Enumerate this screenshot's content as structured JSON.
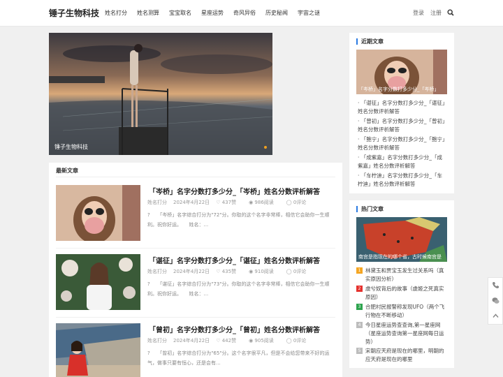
{
  "site": {
    "logo": "锤子生物科技"
  },
  "nav": [
    "姓名打分",
    "姓名测算",
    "宝宝取名",
    "星座运势",
    "奇风异俗",
    "历史秘闻",
    "宇宙之谜"
  ],
  "auth": {
    "login": "登录",
    "register": "注册"
  },
  "banner": {
    "caption": "锤子生物科技"
  },
  "latest": {
    "title": "最新文章",
    "articles": [
      {
        "title": "「岑桥」名字分数打多少分_「岑桥」姓名分数评析解答",
        "category": "姓名打分",
        "date": "2024年4月22日",
        "likes": "437赞",
        "views": "986阅读",
        "comments": "0评论",
        "excerpt": "?　　「岑桥」名字综合打分为\"72\"分。你取的这个名字非常棒，相信它会助你一生顺利。祝你好运。　　姓名：..."
      },
      {
        "title": "「谌征」名字分数打多少分_「谌征」姓名分数评析解答",
        "category": "姓名打分",
        "date": "2024年4月22日",
        "likes": "435赞",
        "views": "910阅读",
        "comments": "0评论",
        "excerpt": "?　　「谌征」名字综合打分为\"73\"分。你取的这个名字非常棒，相信它会助你一生顺利。祝你好运。　　姓名：..."
      },
      {
        "title": "「曾初」名字分数打多少分_「曾初」姓名分数评析解答",
        "category": "姓名打分",
        "date": "2024年4月22日",
        "likes": "442赞",
        "views": "905阅读",
        "comments": "0评论",
        "excerpt": "?　　「曾初」名字综合打分为\"65\"分。这个名字很平凡，但是不会给您带来不好的运气，做事只要有恒心，还是会有..."
      }
    ]
  },
  "recent": {
    "title": "近期文章",
    "thumb_caption": "「岑桥」名字分数打多少分_「岑桥」",
    "items": [
      "「谌征」名字分数打多少分_「谌征」姓名分数评析解答",
      "「曾初」名字分数打多少分_「曾初」姓名分数评析解答",
      "「鲍宁」名字分数打多少分_「鲍宁」姓名分数评析解答",
      "「成紫嘉」名字分数打多少分_「成紫嘉」姓名分数评析解答",
      "「车柠迪」名字分数打多少分_「车柠迪」姓名分数评析解答"
    ]
  },
  "hot": {
    "title": "热门文章",
    "thumb_caption": "南宫是指现在的哪个省，古时候南宫是",
    "items": [
      {
        "num": "1",
        "color": "#f5a623",
        "text": "林黛玉和贾宝玉发生过关系吗（真实原因分析）"
      },
      {
        "num": "2",
        "color": "#e5322e",
        "text": "虞兮奴背后的故事（虞姬之死真实原因）"
      },
      {
        "num": "3",
        "color": "#2ea44f",
        "text": "合肥村民报警称发现UFO（两个飞行物在不断移动）"
      },
      {
        "num": "4",
        "color": "#bdbdbd",
        "text": "今日星座运势查查询,第一星座网（星座运势查询第一星座网每日运势）"
      },
      {
        "num": "5",
        "color": "#bdbdbd",
        "text": "宋朝应天府是现在的哪里，明朝的应天府是现在的哪里"
      }
    ]
  }
}
